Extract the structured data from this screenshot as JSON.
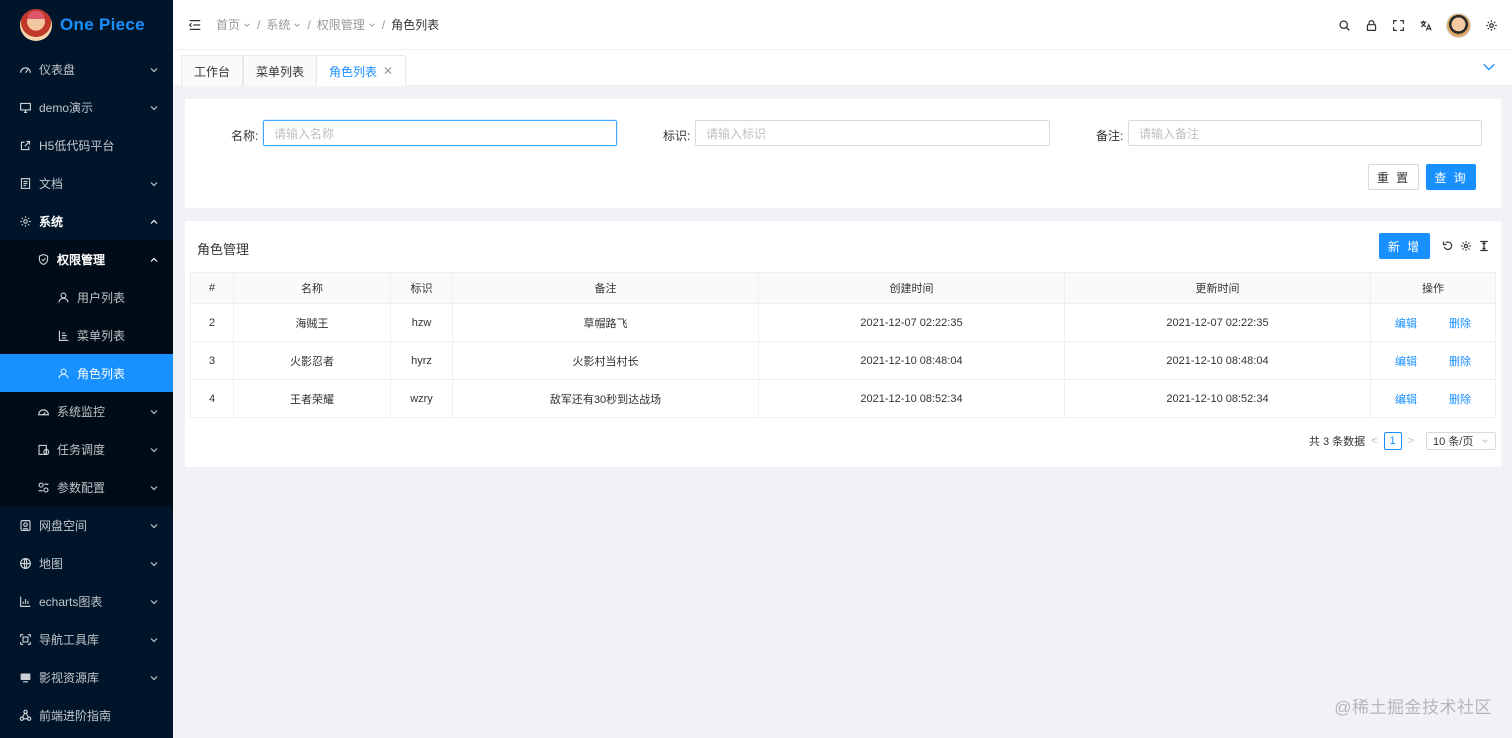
{
  "app": {
    "title": "One Piece"
  },
  "sidebar": {
    "items": [
      {
        "label": "仪表盘",
        "icon": "dashboard-icon"
      },
      {
        "label": "demo演示",
        "icon": "desktop-icon"
      },
      {
        "label": "H5低代码平台",
        "icon": "external-link-icon"
      },
      {
        "label": "文档",
        "icon": "document-icon"
      },
      {
        "label": "系统",
        "icon": "gear-icon"
      },
      {
        "label": "权限管理",
        "icon": "shield-icon"
      },
      {
        "label": "用户列表",
        "icon": "user-icon"
      },
      {
        "label": "菜单列表",
        "icon": "menu-list-icon"
      },
      {
        "label": "角色列表",
        "icon": "user-icon"
      },
      {
        "label": "系统监控",
        "icon": "monitor-icon"
      },
      {
        "label": "任务调度",
        "icon": "schedule-icon"
      },
      {
        "label": "参数配置",
        "icon": "config-icon"
      },
      {
        "label": "网盘空间",
        "icon": "cloud-disk-icon"
      },
      {
        "label": "地图",
        "icon": "globe-icon"
      },
      {
        "label": "echarts图表",
        "icon": "chart-icon"
      },
      {
        "label": "导航工具库",
        "icon": "nav-tool-icon"
      },
      {
        "label": "影视资源库",
        "icon": "video-icon"
      },
      {
        "label": "前端进阶指南",
        "icon": "cluster-icon"
      }
    ]
  },
  "header": {
    "breadcrumb": [
      "首页",
      "系统",
      "权限管理",
      "角色列表"
    ],
    "actions": [
      "search-icon",
      "lock-icon",
      "fullscreen-icon",
      "translate-icon",
      "avatar",
      "gear-icon"
    ]
  },
  "tabs": [
    "工作台",
    "菜单列表",
    "角色列表"
  ],
  "search": {
    "name_label": "名称:",
    "name_placeholder": "请输入名称",
    "code_label": "标识:",
    "code_placeholder": "请输入标识",
    "remark_label": "备注:",
    "remark_placeholder": "请输入备注",
    "reset": "重 置",
    "query": "查 询"
  },
  "table": {
    "title": "角色管理",
    "add_button": "新 增",
    "columns": [
      "#",
      "名称",
      "标识",
      "备注",
      "创建时间",
      "更新时间",
      "操作"
    ],
    "rows": [
      {
        "id": "2",
        "name": "海贼王",
        "code": "hzw",
        "remark": "草帽路飞",
        "created": "2021-12-07 02:22:35",
        "updated": "2021-12-07 02:22:35",
        "edit": "编辑",
        "delete": "删除"
      },
      {
        "id": "3",
        "name": "火影忍者",
        "code": "hyrz",
        "remark": "火影村当村长",
        "created": "2021-12-10 08:48:04",
        "updated": "2021-12-10 08:48:04",
        "edit": "编辑",
        "delete": "删除"
      },
      {
        "id": "4",
        "name": "王者荣耀",
        "code": "wzry",
        "remark": "敌军还有30秒到达战场",
        "created": "2021-12-10 08:52:34",
        "updated": "2021-12-10 08:52:34",
        "edit": "编辑",
        "delete": "删除"
      }
    ],
    "pagination": {
      "total": "共 3 条数据",
      "current": "1",
      "page_size": "10 条/页"
    }
  },
  "watermark": "@稀土掘金技术社区",
  "colors": {
    "sidebar_bg": "#001529",
    "accent": "#1890ff",
    "page_bg": "#f0f2f5"
  }
}
